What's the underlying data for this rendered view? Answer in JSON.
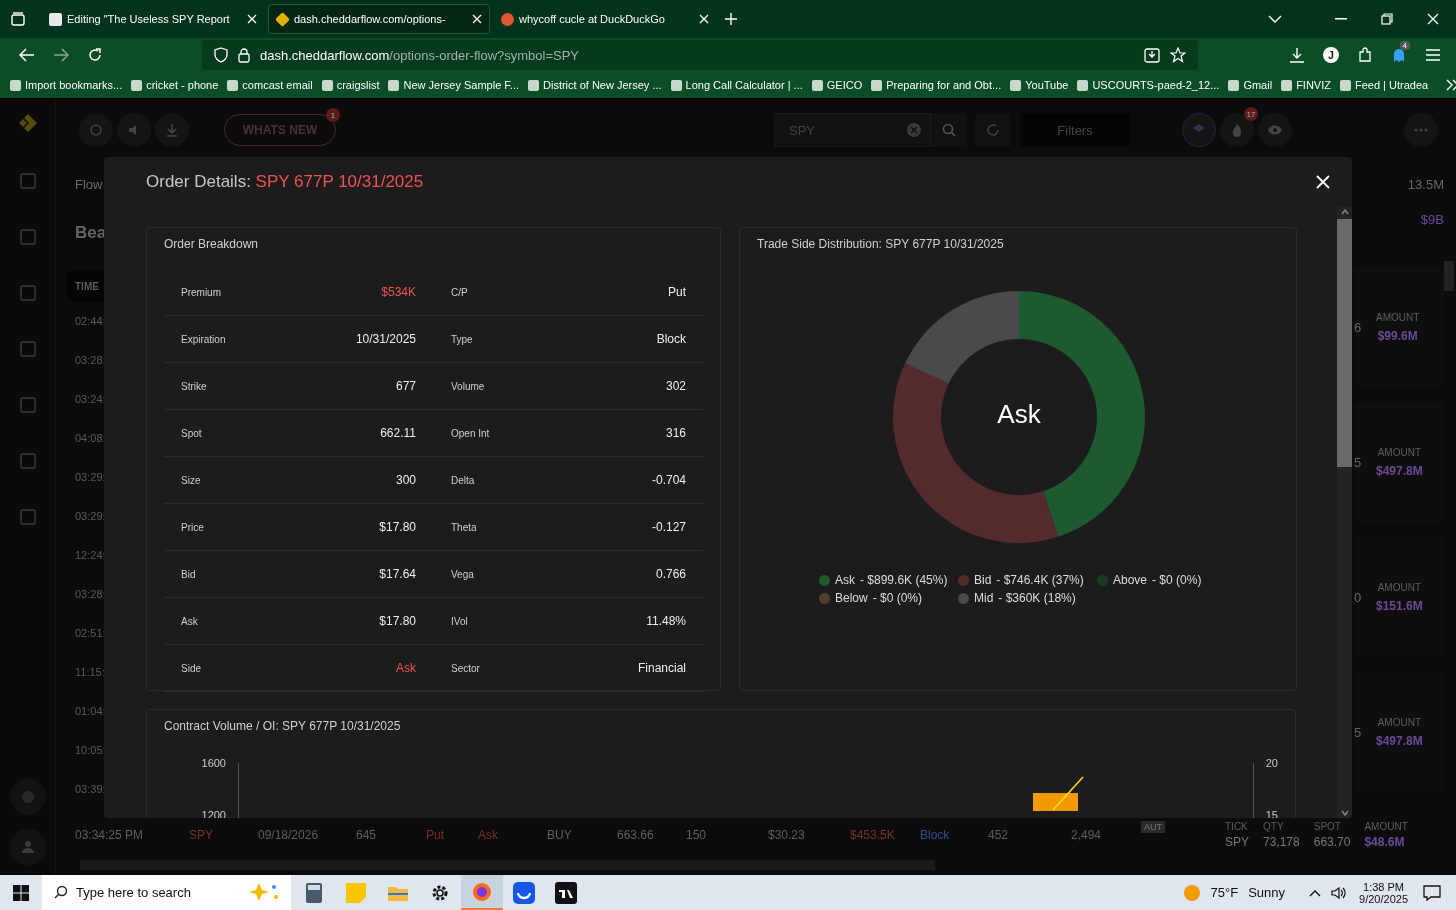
{
  "browser": {
    "tabs": [
      {
        "title": "Editing \"The Useless SPY Report",
        "selected": false
      },
      {
        "title": "dash.cheddarflow.com/options-",
        "selected": true
      },
      {
        "title": "whycoff cucle at DuckDuckGo",
        "selected": false
      }
    ],
    "url_host": "dash.cheddarflow.com",
    "url_path": "/options-order-flow?symbol=SPY",
    "extensions_badge": "4",
    "profile_initial": "J",
    "bookmarks": [
      "Import bookmarks...",
      "cricket - phone",
      "comcast email",
      "craigslist",
      "New Jersey Sample F...",
      "District of New Jersey ...",
      "Long Call Calculator | ...",
      "GEICO",
      "Preparing for and Obt...",
      "YouTube",
      "USCOURTS-paed-2_12...",
      "Gmail",
      "FINVIZ",
      "Feed | Utradea"
    ]
  },
  "app_header": {
    "whats_new": "WHATS NEW",
    "whats_new_badge": "1",
    "search_value": "SPY",
    "filters": "Filters",
    "fire_badge": "17"
  },
  "background": {
    "left": {
      "section": "Flow",
      "heading": "Bea",
      "time_header": "TIME",
      "times": [
        "02:44:",
        "03:28:",
        "03:24:",
        "04:08:",
        "03:29:",
        "03:29:",
        "12:24:",
        "03:28:",
        "02:51:",
        "11:15:",
        "01:04:",
        "10:05:",
        "03:39:"
      ]
    },
    "right": {
      "top_value": "13.5M",
      "total": "$9B",
      "cards": [
        {
          "edge": "6",
          "label": "AMOUNT",
          "amount": "$99.6M"
        },
        {
          "edge": "5",
          "label": "AMOUNT",
          "amount": "$497.8M"
        },
        {
          "edge": "0",
          "label": "AMOUNT",
          "amount": "$151.6M"
        },
        {
          "edge": "5",
          "label": "AMOUNT",
          "amount": "$497.8M"
        }
      ]
    },
    "bottom_row": {
      "cells": [
        "03:34:25 PM",
        "SPY",
        "09/18/2026",
        "645",
        "Put",
        "Ask",
        "BUY",
        "663.66",
        "150",
        "$30.23",
        "$453.5K",
        "Block",
        "452",
        "2,494"
      ],
      "tag": "AUT",
      "summary": [
        {
          "label": "TICK",
          "value": "SPY"
        },
        {
          "label": "QTY",
          "value": "73,178"
        },
        {
          "label": "SPOT",
          "value": "663.70"
        },
        {
          "label": "AMOUNT",
          "value": "$48.6M"
        }
      ]
    }
  },
  "modal": {
    "title": "Order Details:",
    "contract": "SPY 677P 10/31/2025",
    "breakdown": {
      "title": "Order Breakdown",
      "rows": [
        {
          "left": {
            "label": "Premium",
            "value": "$534K",
            "highlight": true
          },
          "right": {
            "label": "C/P",
            "value": "Put",
            "highlight": false
          }
        },
        {
          "left": {
            "label": "Expiration",
            "value": "10/31/2025",
            "highlight": false
          },
          "right": {
            "label": "Type",
            "value": "Block",
            "highlight": false
          }
        },
        {
          "left": {
            "label": "Strike",
            "value": "677",
            "highlight": false
          },
          "right": {
            "label": "Volume",
            "value": "302",
            "highlight": false
          }
        },
        {
          "left": {
            "label": "Spot",
            "value": "662.11",
            "highlight": false
          },
          "right": {
            "label": "Open Int",
            "value": "316",
            "highlight": false
          }
        },
        {
          "left": {
            "label": "Size",
            "value": "300",
            "highlight": false
          },
          "right": {
            "label": "Delta",
            "value": "-0.704",
            "highlight": false
          }
        },
        {
          "left": {
            "label": "Price",
            "value": "$17.80",
            "highlight": false
          },
          "right": {
            "label": "Theta",
            "value": "-0.127",
            "highlight": false
          }
        },
        {
          "left": {
            "label": "Bid",
            "value": "$17.64",
            "highlight": false
          },
          "right": {
            "label": "Vega",
            "value": "0.766",
            "highlight": false
          }
        },
        {
          "left": {
            "label": "Ask",
            "value": "$17.80",
            "highlight": false
          },
          "right": {
            "label": "IVol",
            "value": "11.48%",
            "highlight": false
          }
        },
        {
          "left": {
            "label": "Side",
            "value": "Ask",
            "highlight": true
          },
          "right": {
            "label": "Sector",
            "value": "Financial",
            "highlight": false
          }
        }
      ]
    },
    "distribution": {
      "chart_data": {
        "type": "donut",
        "title": "Trade Side Distribution: SPY 677P 10/31/2025",
        "categories": [
          "Ask",
          "Bid",
          "Above",
          "Below",
          "Mid"
        ],
        "values": [
          45,
          37,
          0,
          0,
          18
        ]
      },
      "center_label": "Ask",
      "legend": [
        {
          "detail": "- $899.6K (45%)",
          "color": "#1d5a30"
        },
        {
          "detail": "- $746.4K (37%)",
          "color": "#552a2c"
        },
        {
          "detail": "- $0 (0%)",
          "color": "#1c3a22"
        },
        {
          "detail": "- $0 (0%)",
          "color": "#4d4128"
        },
        {
          "detail": "- $360K (18%)",
          "color": "#4a4a4c"
        }
      ]
    },
    "volume": {
      "title": "Contract Volume / OI: SPY 677P 10/31/2025",
      "left_ticks": [
        "1600",
        "1200"
      ],
      "right_ticks": [
        "20",
        "15"
      ]
    }
  },
  "taskbar": {
    "search_placeholder": "Type here to search",
    "temperature": "75°F",
    "weather": "Sunny",
    "time": "1:38 PM",
    "date": "9/20/2025"
  }
}
